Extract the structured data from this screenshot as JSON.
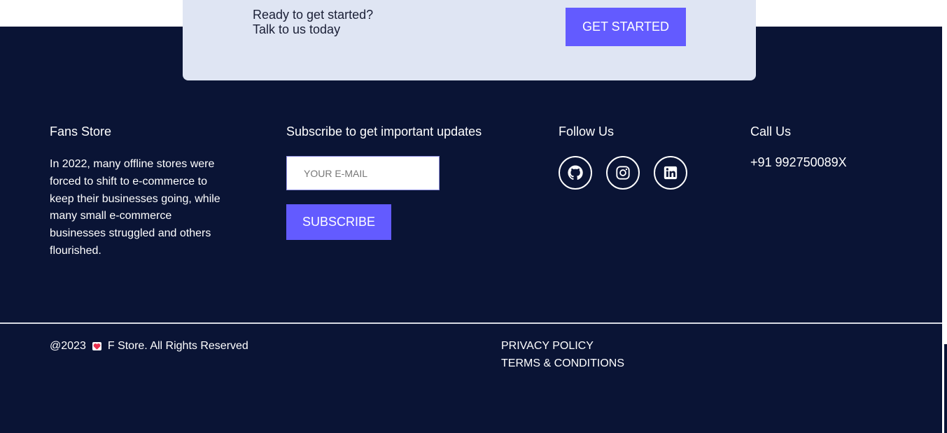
{
  "cta": {
    "line1": "Ready to get started?",
    "line2": "Talk to us today",
    "button": "GET STARTED"
  },
  "about": {
    "title": "Fans Store",
    "text": "In 2022, many offline stores were forced to shift to e-commerce to keep their businesses going, while many small e-commerce businesses struggled and others flourished."
  },
  "subscribe": {
    "title": "Subscribe to get important updates",
    "placeholder": "YOUR E-MAIL",
    "button": "SUBSCRIBE"
  },
  "follow": {
    "title": "Follow Us",
    "icons": [
      "github-icon",
      "instagram-icon",
      "linkedin-icon"
    ]
  },
  "call": {
    "title": "Call Us",
    "phone": "+91 992750089X"
  },
  "bottom": {
    "year": "@2023",
    "brand": "F Store. All Rights Reserved",
    "privacy": "PRIVACY POLICY",
    "terms": "TERMS & CONDITIONS"
  },
  "colors": {
    "footer_bg": "#0a1435",
    "accent": "#635bff",
    "cta_bg": "#dfe5f3",
    "heart": "#e8314f"
  }
}
